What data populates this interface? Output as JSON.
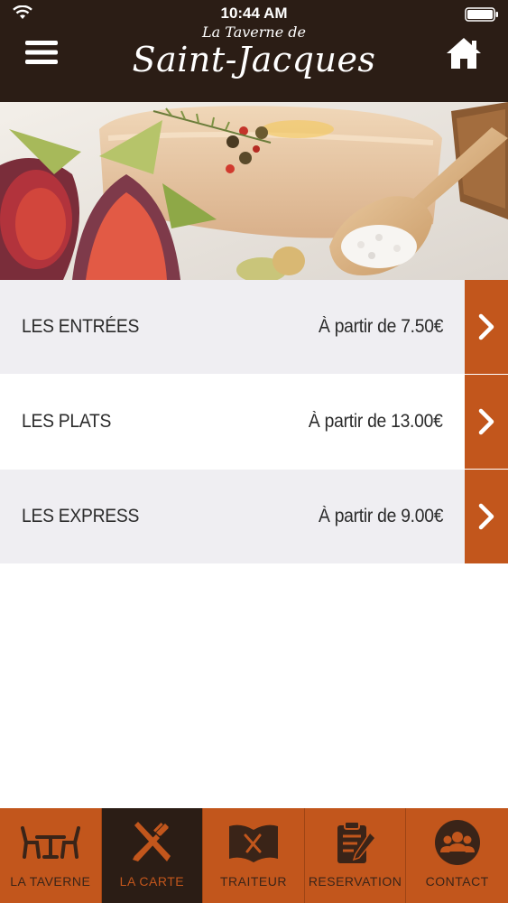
{
  "status_bar": {
    "time": "10:44 AM"
  },
  "header": {
    "logo_line1": "La Taverne de",
    "logo_line2": "Saint-Jacques"
  },
  "menu": {
    "items": [
      {
        "name": "LES ENTRÉES",
        "price": "À partir de 7.50€"
      },
      {
        "name": "LES PLATS",
        "price": "À partir de 13.00€"
      },
      {
        "name": "LES EXPRESS",
        "price": "À partir de 9.00€"
      }
    ]
  },
  "tabbar": {
    "tabs": [
      {
        "label": "LA TAVERNE",
        "icon": "table-chairs-icon"
      },
      {
        "label": "LA CARTE",
        "icon": "fork-knife-icon",
        "active": true
      },
      {
        "label": "TRAITEUR",
        "icon": "catering-book-icon"
      },
      {
        "label": "RESERVATION",
        "icon": "clipboard-pen-icon"
      },
      {
        "label": "CONTACT",
        "icon": "group-icon"
      }
    ]
  },
  "colors": {
    "header_bg": "#2b1d15",
    "accent": "#c2561c",
    "row_alt_bg": "#efeef2"
  }
}
